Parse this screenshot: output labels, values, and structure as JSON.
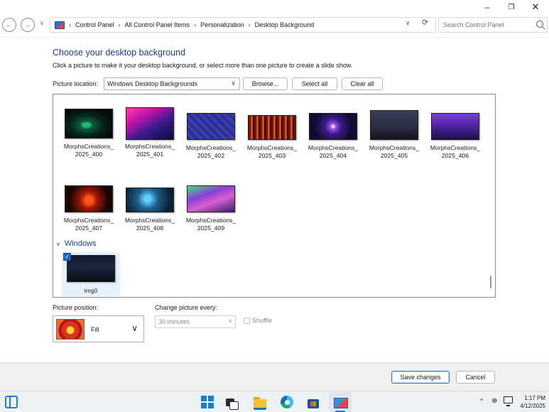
{
  "window": {
    "min_label": "–",
    "max_label": "❐",
    "close_label": "✕"
  },
  "address": {
    "back_glyph": "←",
    "forward_glyph": "→",
    "recent_glyph": "∨",
    "crumbs": [
      "Control Panel",
      "All Control Panel Items",
      "Personalization",
      "Desktop Background"
    ],
    "crumb_sep": "›",
    "dropdown_glyph": "∨",
    "refresh_glyph": "⟳",
    "search_placeholder": "Search Control Panel"
  },
  "main": {
    "heading": "Choose your desktop background",
    "subtext": "Click a picture to make it your desktop background, or select more than one picture to create a slide show.",
    "location_label": "Picture location:",
    "location_value": "Windows Desktop Backgrounds",
    "browse_label": "Browse...",
    "select_all_label": "Select all",
    "clear_all_label": "Clear all"
  },
  "pictures": [
    {
      "line1": "MorphsCreations_",
      "line2": "2025_400"
    },
    {
      "line1": "MorphsCreations_",
      "line2": "2025_401"
    },
    {
      "line1": "MorphsCreations_",
      "line2": "2025_402"
    },
    {
      "line1": "MorphsCreations_",
      "line2": "2025_403"
    },
    {
      "line1": "MorphsCreations_",
      "line2": "2025_404"
    },
    {
      "line1": "MorphsCreations_",
      "line2": "2025_405"
    },
    {
      "line1": "MorphsCreations_",
      "line2": "2025_406"
    },
    {
      "line1": "MorphsCreations_",
      "line2": "2025_407"
    },
    {
      "line1": "MorphsCreations_",
      "line2": "2025_408"
    },
    {
      "line1": "MorphsCreations_",
      "line2": "2025_409"
    }
  ],
  "windows_group": {
    "header": "Windows",
    "chevron": "∨",
    "item_label": "img0",
    "checked_glyph": "✓"
  },
  "position": {
    "label": "Picture position:",
    "value": "Fill",
    "dropdown_glyph": "∨"
  },
  "change": {
    "label": "Change picture every:",
    "value": "30 minutes",
    "dropdown_glyph": "∨",
    "shuffle_label": "Shuffle"
  },
  "footer": {
    "save_label": "Save changes",
    "cancel_label": "Cancel"
  },
  "taskbar": {
    "tray_up_glyph": "^",
    "network_glyph": "⊕",
    "time": "1:17 PM",
    "date": "4/12/2025"
  },
  "colors": {
    "heading_blue": "#1e3a8a",
    "accent": "#1a7fd4",
    "selection_bg": "#e5f1fb"
  }
}
